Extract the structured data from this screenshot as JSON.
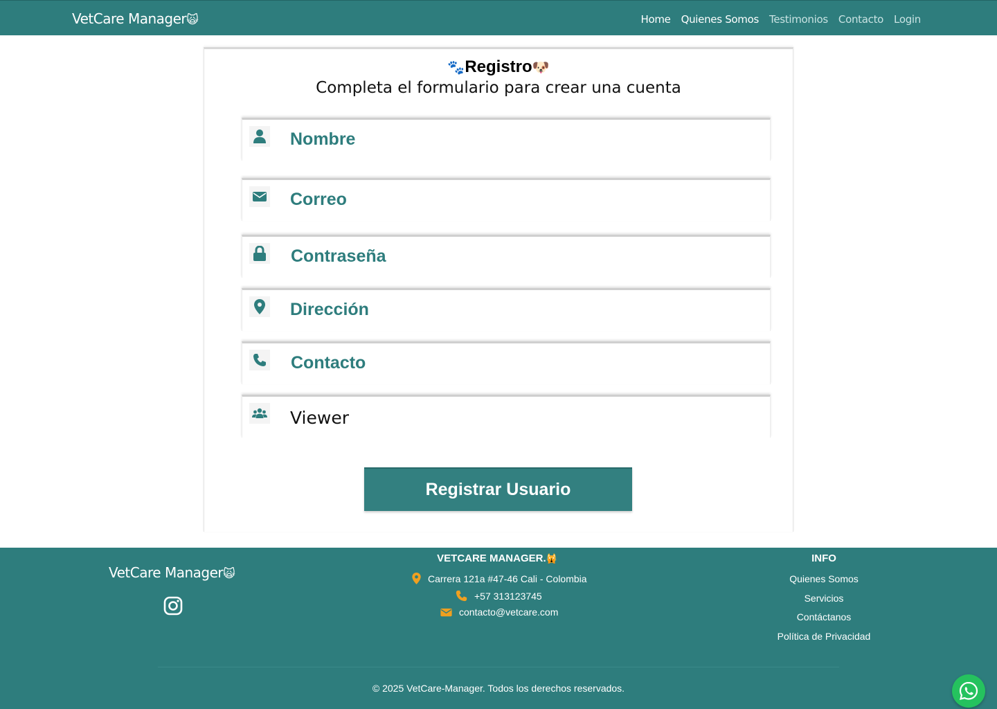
{
  "navbar": {
    "brand": "VetCare Manager",
    "links": [
      "Home",
      "Quienes Somos",
      "Testimonios",
      "Contacto",
      "Login"
    ]
  },
  "form": {
    "title": "Registro",
    "subtitle": "Completa el formulario para crear una cuenta",
    "fields": [
      {
        "placeholder": "Nombre",
        "icon": "user-icon"
      },
      {
        "placeholder": "Correo",
        "icon": "envelope-icon"
      },
      {
        "placeholder": "Contraseña",
        "icon": "lock-icon"
      },
      {
        "placeholder": "Dirección",
        "icon": "map-pin-icon"
      },
      {
        "placeholder": "Contacto",
        "icon": "phone-icon"
      }
    ],
    "role_select": {
      "value": "Viewer",
      "icon": "users-icon"
    },
    "submit_label": "Registrar Usuario"
  },
  "footer": {
    "brand": "VetCare Manager",
    "company_title": "VETCARE MANAGER.",
    "address": "Carrera 121a #47-46 Cali - Colombia",
    "phone": "+57 313123745",
    "email": "contacto@vetcare.com",
    "info_title": "INFO",
    "info_links": [
      "Quienes Somos",
      "Servicios",
      "Contáctanos",
      "Política de Privacidad"
    ],
    "copyright": "© 2025 VetCare-Manager. Todos los derechos reservados."
  },
  "colors": {
    "primary": "#2e7d7d",
    "accent_orange": "#f0a020",
    "whatsapp": "#25c25e"
  }
}
